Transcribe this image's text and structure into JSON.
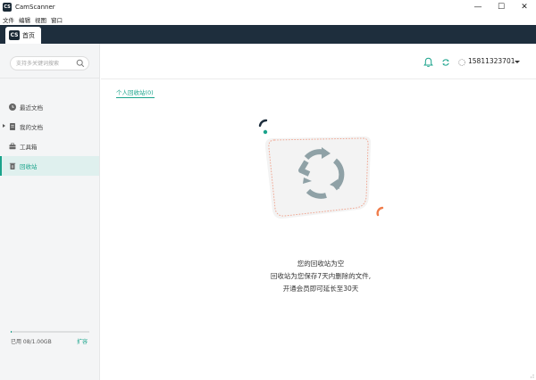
{
  "window": {
    "title": "CamScanner",
    "logo_text": "CS",
    "controls": {
      "minimize": "—",
      "maximize": "☐",
      "close": "✕"
    }
  },
  "menu": [
    "文件",
    "编辑",
    "视图",
    "窗口"
  ],
  "tabs": {
    "home": {
      "logo_text": "CS",
      "label": "首页"
    }
  },
  "sidebar": {
    "search_placeholder": "支持多关键词搜索",
    "items": [
      {
        "label": "最近文档",
        "icon": "clock-icon"
      },
      {
        "label": "我的文档",
        "icon": "document-icon"
      },
      {
        "label": "工具箱",
        "icon": "toolbox-icon"
      },
      {
        "label": "回收站",
        "icon": "trash-icon"
      }
    ],
    "storage": {
      "used_label": "已用 08/1.00GB",
      "expand_label": "扩容",
      "used_fraction": 0.01
    }
  },
  "header": {
    "user": "15811323701"
  },
  "content": {
    "tab_label": "个人回收站(0)",
    "empty_title": "您的回收站为空",
    "empty_line1": "回收站为您保存7天内删除的文件,",
    "empty_line2": "开通会员即可延长至30天"
  },
  "colors": {
    "accent": "#1aa38b",
    "tabbar": "#1e2e3d",
    "sidebar_bg": "#f4f5f6",
    "recycle_arrows": "#8fa1a6",
    "dashed_border": "#f0a08a"
  }
}
